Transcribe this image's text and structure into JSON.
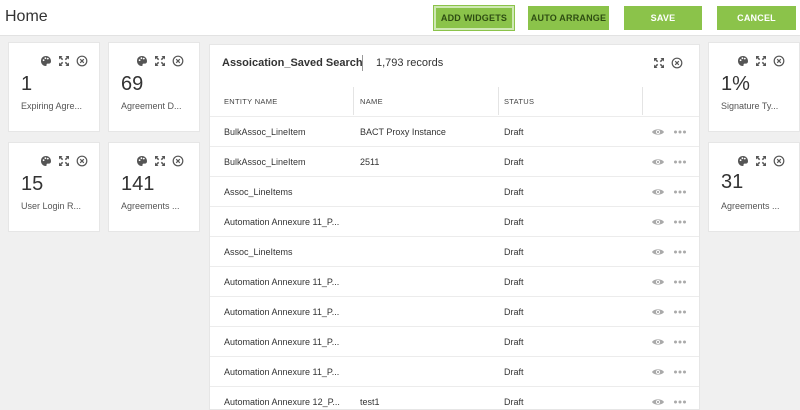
{
  "header": {
    "title": "Home",
    "buttons": {
      "add_widgets": "ADD WIDGETS",
      "auto_arrange": "AUTO ARRANGE",
      "save": "SAVE",
      "cancel": "CANCEL"
    }
  },
  "widgets": [
    {
      "value": "1",
      "label": "Expiring Agre..."
    },
    {
      "value": "69",
      "label": "Agreement D..."
    },
    {
      "value": "15",
      "label": "User Login R..."
    },
    {
      "value": "141",
      "label": "Agreements ..."
    },
    {
      "value": "1%",
      "label": "Signature Ty..."
    },
    {
      "value": "31",
      "label": "Agreements ..."
    }
  ],
  "panel": {
    "title": "Assoication_Saved Search",
    "count": "1,793 records",
    "columns": [
      "ENTITY NAME",
      "NAME",
      "STATUS"
    ],
    "rows": [
      {
        "entity": "BulkAssoc_LineItem",
        "name": "BACT Proxy Instance",
        "status": "Draft"
      },
      {
        "entity": "BulkAssoc_LineItem",
        "name": "2511",
        "status": "Draft"
      },
      {
        "entity": "Assoc_LineItems",
        "name": "",
        "status": "Draft"
      },
      {
        "entity": "Automation Annexure 11_P...",
        "name": "",
        "status": "Draft"
      },
      {
        "entity": "Assoc_LineItems",
        "name": "",
        "status": "Draft"
      },
      {
        "entity": "Automation Annexure 11_P...",
        "name": "",
        "status": "Draft"
      },
      {
        "entity": "Automation Annexure 11_P...",
        "name": "",
        "status": "Draft"
      },
      {
        "entity": "Automation Annexure 11_P...",
        "name": "",
        "status": "Draft"
      },
      {
        "entity": "Automation Annexure 11_P...",
        "name": "",
        "status": "Draft"
      },
      {
        "entity": "Automation Annexure 12_P...",
        "name": "test1",
        "status": "Draft"
      }
    ]
  },
  "icons": {
    "palette": "palette-icon",
    "expand": "expand-icon",
    "close": "close-circle-icon",
    "eye": "eye-icon",
    "more": "more-icon"
  },
  "colors": {
    "accent_green": "#8bc34a",
    "icon_gray": "#555555",
    "row_icon_gray": "#aaaaaa"
  }
}
